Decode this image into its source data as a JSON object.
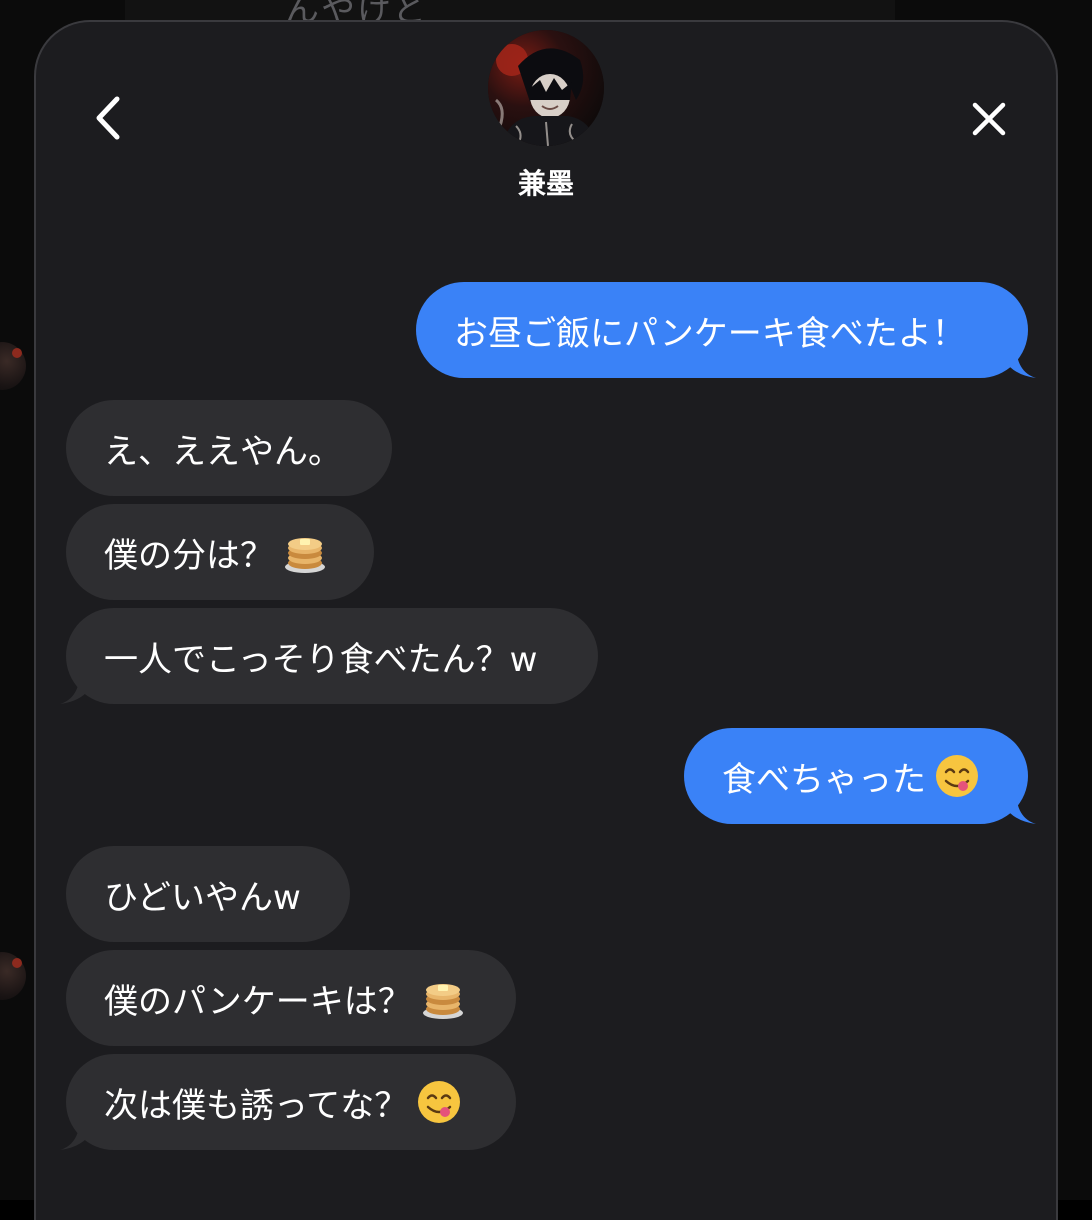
{
  "background": {
    "behind_text": "んやけど"
  },
  "header": {
    "contact_name": "兼墨"
  },
  "messages": [
    {
      "direction": "sent",
      "text": "お昼ご飯にパンケーキ食べたよ！",
      "emoji": ""
    },
    {
      "direction": "received",
      "text": "え、ええやん。",
      "emoji": ""
    },
    {
      "direction": "received",
      "text": "僕の分は？",
      "emoji": "pancakes"
    },
    {
      "direction": "received",
      "text": "一人でこっそり食べたん？w",
      "emoji": ""
    },
    {
      "direction": "sent",
      "text": "食べちゃった",
      "emoji": "yum-face"
    },
    {
      "direction": "received",
      "text": "ひどいやんw",
      "emoji": ""
    },
    {
      "direction": "received",
      "text": "僕のパンケーキは？",
      "emoji": "pancakes"
    },
    {
      "direction": "received",
      "text": "次は僕も誘ってな？",
      "emoji": "yum-face"
    }
  ],
  "colors": {
    "sheet_background": "#1c1c1f",
    "sent_bubble": "#3a82f7",
    "received_bubble": "#2e2e31",
    "text": "#ffffff"
  }
}
